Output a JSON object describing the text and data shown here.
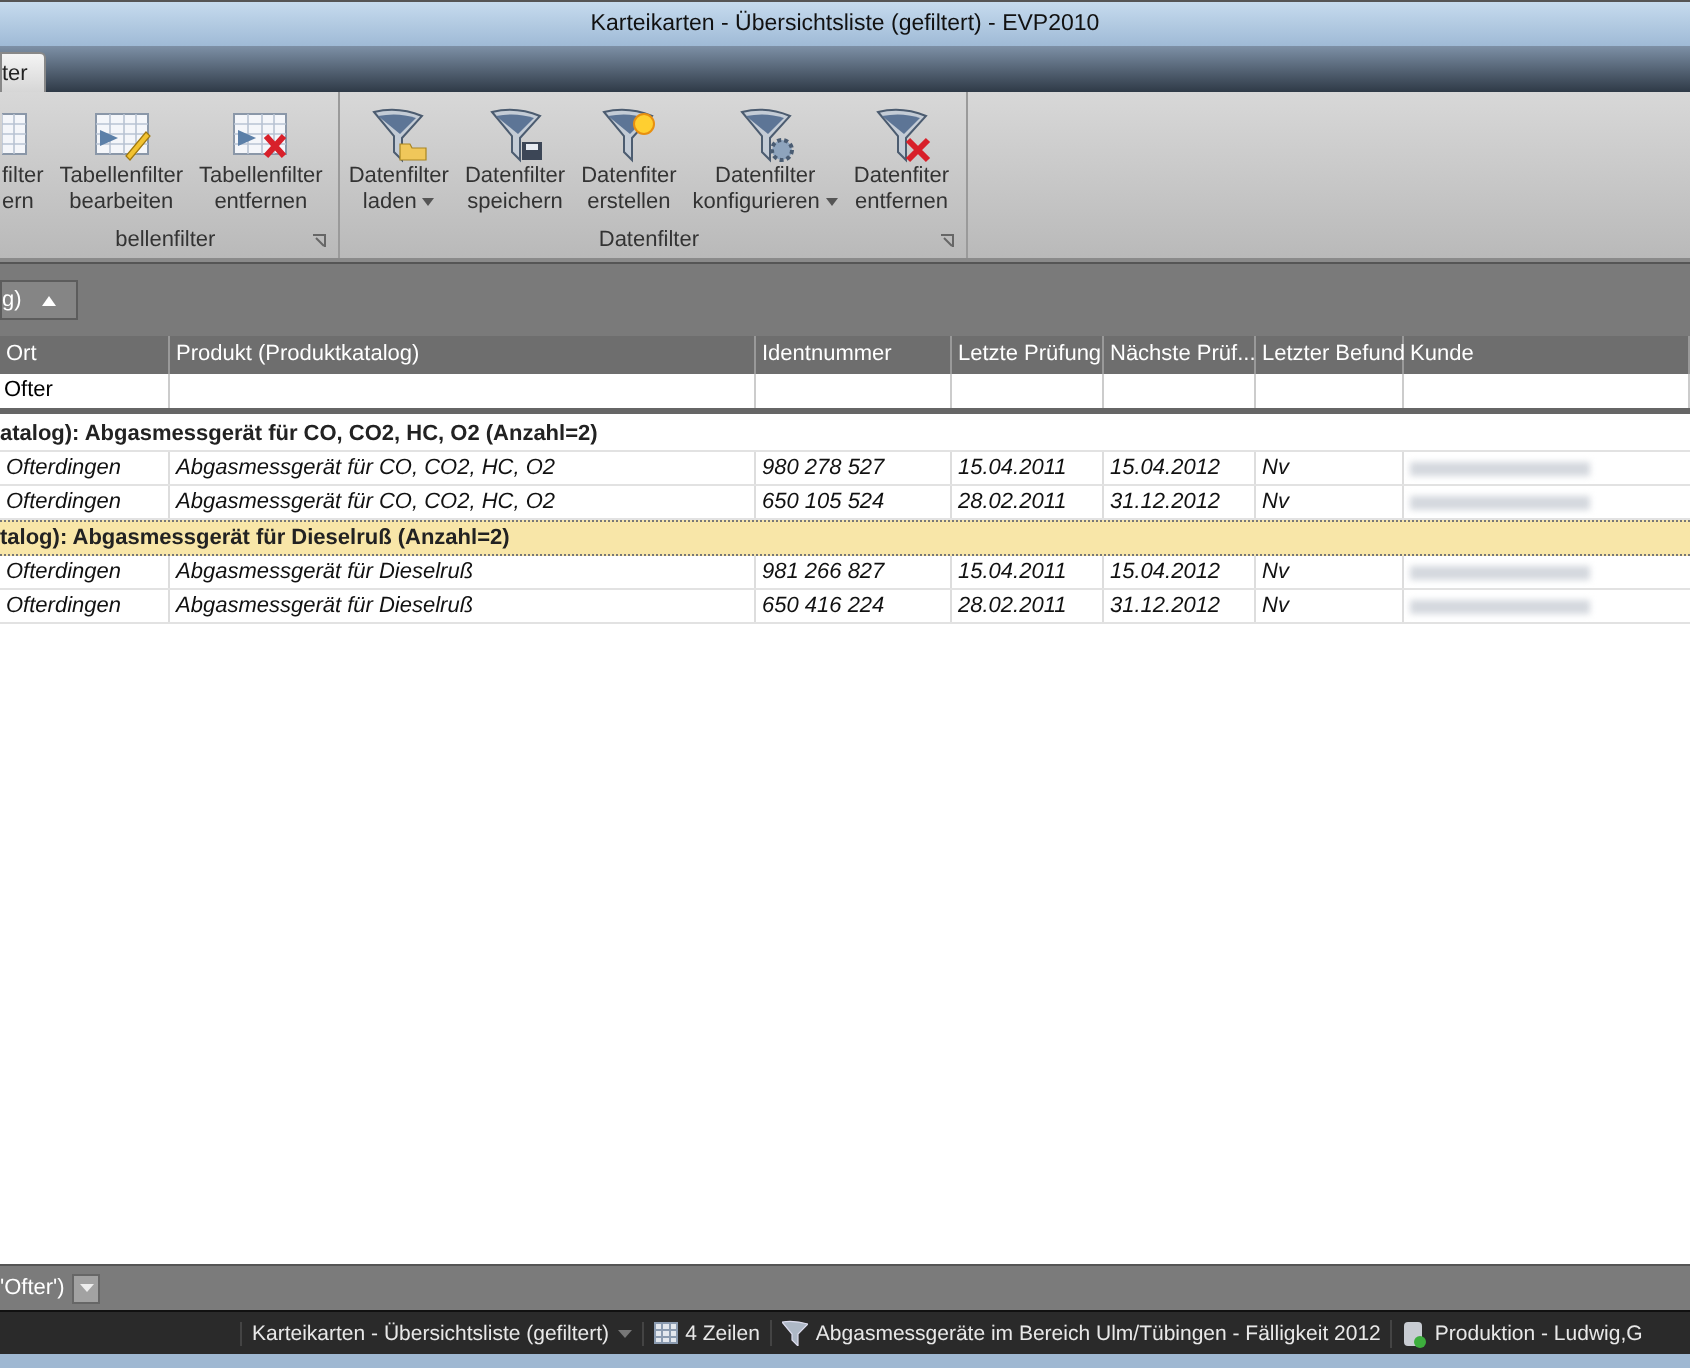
{
  "window": {
    "title": "Karteikarten - Übersichtsliste (gefiltert) - EVP2010"
  },
  "tabs": [
    {
      "label": "ter",
      "selected": true
    }
  ],
  "ribbon": {
    "groups": [
      {
        "label": "bellenfilter",
        "buttons": [
          {
            "kind": "table",
            "lines": [
              "filter",
              "ern"
            ],
            "dropdown": false
          },
          {
            "kind": "table-edit",
            "lines": [
              "Tabellenfilter",
              "bearbeiten"
            ],
            "dropdown": false
          },
          {
            "kind": "table-remove",
            "lines": [
              "Tabellenfilter",
              "entfernen"
            ],
            "dropdown": false
          }
        ]
      },
      {
        "label": "Datenfilter",
        "buttons": [
          {
            "kind": "filter-folder",
            "lines": [
              "Datenfilter",
              "laden"
            ],
            "dropdown": true
          },
          {
            "kind": "filter-disk",
            "lines": [
              "Datenfilter",
              "speichern"
            ],
            "dropdown": false
          },
          {
            "kind": "filter-star",
            "lines": [
              "Datenfiter",
              "erstellen"
            ],
            "dropdown": false
          },
          {
            "kind": "filter-gear",
            "lines": [
              "Datenfilter",
              "konfigurieren"
            ],
            "dropdown": true
          },
          {
            "kind": "filter-remove",
            "lines": [
              "Datenfiter",
              "entfernen"
            ],
            "dropdown": false
          }
        ]
      }
    ]
  },
  "grouping": {
    "chip": "g)"
  },
  "table": {
    "columns": [
      "Ort",
      "Produkt (Produktkatalog)",
      "Identnummer",
      "Letzte Prüfung",
      "Nächste Prüf...",
      "Letzter Befund",
      "Kunde"
    ],
    "filter_row": {
      "value": "Ofter"
    },
    "groups": [
      {
        "label": "atalog): Abgasmessgerät für CO, CO2, HC, O2 (Anzahl=2)",
        "selected": false,
        "rows": [
          [
            "Ofterdingen",
            "Abgasmessgerät für CO, CO2, HC, O2",
            "980 278 527",
            "15.04.2011",
            "15.04.2012",
            "Nv"
          ],
          [
            "Ofterdingen",
            "Abgasmessgerät für CO, CO2, HC, O2",
            "650 105 524",
            "28.02.2011",
            "31.12.2012",
            "Nv"
          ]
        ]
      },
      {
        "label": "talog): Abgasmessgerät für Dieselruß (Anzahl=2)",
        "selected": true,
        "rows": [
          [
            "Ofterdingen",
            "Abgasmessgerät für Dieselruß",
            "981 266 827",
            "15.04.2011",
            "15.04.2012",
            "Nv"
          ],
          [
            "Ofterdingen",
            "Abgasmessgerät für Dieselruß",
            "650 416 224",
            "28.02.2011",
            "31.12.2012",
            "Nv"
          ]
        ]
      }
    ]
  },
  "filter_bar": {
    "text": "'Ofter')"
  },
  "status_bar": [
    {
      "kind": "view",
      "text": "Karteikarten - Übersichtsliste (gefiltert)"
    },
    {
      "kind": "rows",
      "text": "4 Zeilen"
    },
    {
      "kind": "filter",
      "text": "Abgasmessgeräte im Bereich Ulm/Tübingen - Fälligkeit 2012"
    },
    {
      "kind": "database",
      "text": "Produktion - Ludwig,G"
    }
  ]
}
